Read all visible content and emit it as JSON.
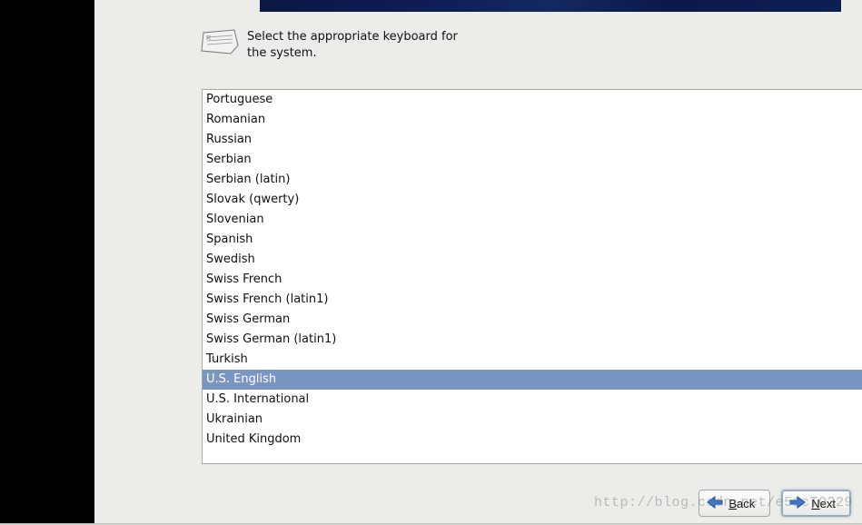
{
  "instruction": "Select the appropriate keyboard for the system.",
  "keyboards": {
    "selected_index": 14,
    "items": [
      "Portuguese",
      "Romanian",
      "Russian",
      "Serbian",
      "Serbian (latin)",
      "Slovak (qwerty)",
      "Slovenian",
      "Spanish",
      "Swedish",
      "Swiss French",
      "Swiss French (latin1)",
      "Swiss German",
      "Swiss German (latin1)",
      "Turkish",
      "U.S. English",
      "U.S. International",
      "Ukrainian",
      "United Kingdom"
    ]
  },
  "buttons": {
    "back_mnemonic": "B",
    "back_rest": "ack",
    "next_mnemonic": "N",
    "next_rest": "ext"
  },
  "colors": {
    "selection_bg": "#7a96c0",
    "banner_dark_blue": "#0e1e56"
  },
  "watermark": "http://blog.csdn.net/e51cTO329"
}
